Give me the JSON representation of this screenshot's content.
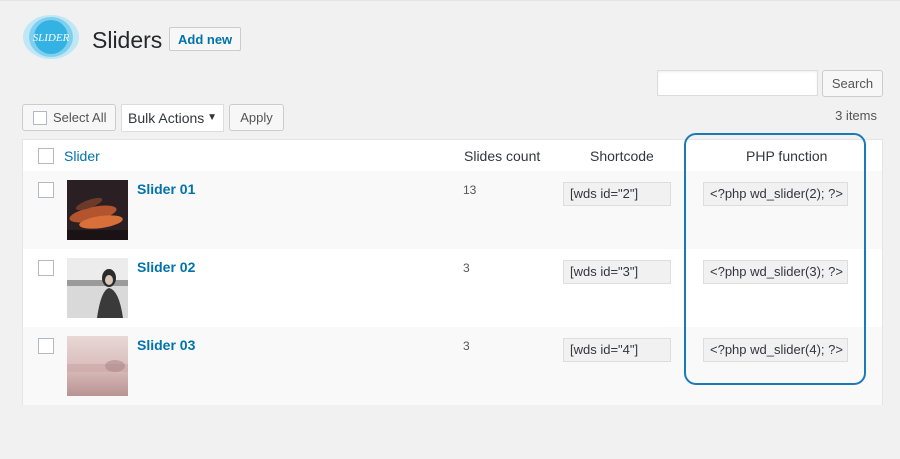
{
  "header": {
    "logo_text": "SLIDER",
    "title": "Sliders",
    "add_new_label": "Add new"
  },
  "search": {
    "placeholder": "",
    "button_label": "Search"
  },
  "toolbar": {
    "select_all_label": "Select All",
    "bulk_actions_label": "Bulk Actions",
    "bulk_arrow": "▼",
    "apply_label": "Apply",
    "items_count": "3 items"
  },
  "table": {
    "columns": {
      "slider": "Slider",
      "slides_count": "Slides count",
      "shortcode": "Shortcode",
      "php_function": "PHP function"
    },
    "rows": [
      {
        "name": "Slider 01",
        "count": "13",
        "shortcode": "[wds id=\"2\"]",
        "php": "<?php wd_slider(2); ?>"
      },
      {
        "name": "Slider 02",
        "count": "3",
        "shortcode": "[wds id=\"3\"]",
        "php": "<?php wd_slider(3); ?>"
      },
      {
        "name": "Slider 03",
        "count": "3",
        "shortcode": "[wds id=\"4\"]",
        "php": "<?php wd_slider(4); ?>"
      }
    ]
  },
  "colors": {
    "link": "#0073aa",
    "highlight_border": "#1a7ab8"
  }
}
